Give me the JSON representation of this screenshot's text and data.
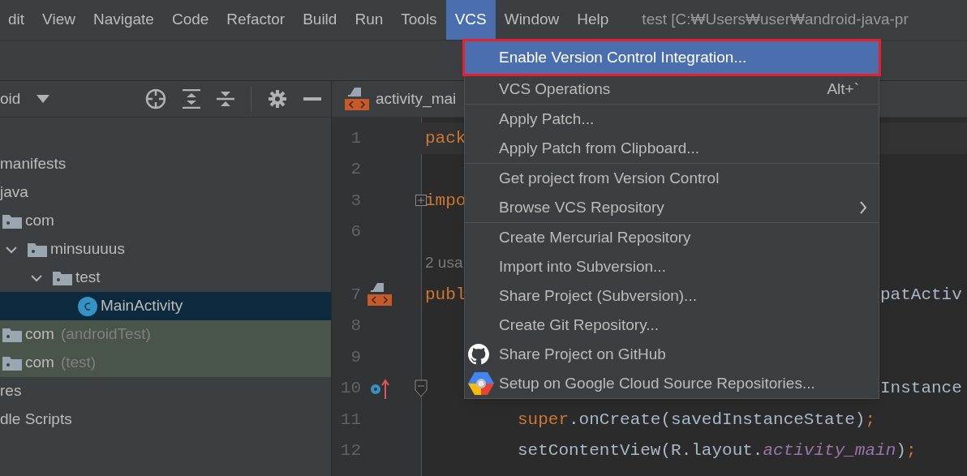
{
  "menu_bar": [
    {
      "label": "dit",
      "selected": false
    },
    {
      "label": "View",
      "selected": false
    },
    {
      "label": "Navigate",
      "selected": false
    },
    {
      "label": "Code",
      "selected": false
    },
    {
      "label": "Refactor",
      "selected": false
    },
    {
      "label": "Build",
      "selected": false
    },
    {
      "label": "Run",
      "selected": false
    },
    {
      "label": "Tools",
      "selected": false
    },
    {
      "label": "VCS",
      "selected": true
    },
    {
      "label": "Window",
      "selected": false
    },
    {
      "label": "Help",
      "selected": false
    }
  ],
  "window": {
    "title": "test [C:₩Users₩user₩android-java-pr"
  },
  "project_panel": {
    "view": "oid",
    "tree": [
      {
        "label": "manifests",
        "selected": false
      },
      {
        "label": "java",
        "selected": false,
        "children": [
          {
            "label": "com",
            "kind": "folder",
            "selected": false,
            "children": [
              {
                "label": "minsuuuus",
                "kind": "folder",
                "selected": false,
                "expanded": true,
                "children": [
                  {
                    "label": "test",
                    "kind": "folder",
                    "selected": false,
                    "expanded": true,
                    "children": [
                      {
                        "label": "MainActivity",
                        "kind": "class",
                        "selected": true
                      }
                    ]
                  }
                ]
              }
            ]
          },
          {
            "label": "com",
            "suffix": "(androidTest)",
            "kind": "test-folder",
            "selected": false
          },
          {
            "label": "com",
            "suffix": "(test)",
            "kind": "test-folder",
            "selected": false
          }
        ]
      },
      {
        "label": "res",
        "selected": false
      },
      {
        "label": "dle Scripts",
        "selected": false
      }
    ]
  },
  "editor": {
    "tab": "activity_mai",
    "lines": [
      {
        "number": "1",
        "current": true,
        "tokens": [
          {
            "text": "pack",
            "kind": "keyword"
          }
        ]
      },
      {
        "number": "2"
      },
      {
        "number": "3",
        "kind": "import",
        "tokens": [
          {
            "text": "impo",
            "kind": "keyword"
          }
        ]
      },
      {
        "number": "6"
      },
      {
        "kind": "hint",
        "tokens": [
          {
            "text": "2 usa",
            "kind": "hint"
          }
        ]
      },
      {
        "number": "7",
        "kind": "class",
        "tokens": [
          {
            "text": "publ",
            "kind": "keyword"
          }
        ],
        "right": "patActiv"
      },
      {
        "number": "8"
      },
      {
        "number": "9"
      },
      {
        "number": "10",
        "kind": "method",
        "right": "Instance"
      },
      {
        "number": "11",
        "indent": true,
        "tokens": [
          {
            "text": "super",
            "kind": "keyword"
          },
          {
            "text": ".onCreate(savedInstanceState)",
            "kind": "plain"
          },
          {
            "text": ";",
            "kind": "keyword"
          }
        ]
      },
      {
        "number": "12",
        "indent": true,
        "tokens": [
          {
            "text": "setContentView(R.layout.",
            "kind": "plain"
          },
          {
            "text": "activity_main",
            "kind": "field"
          },
          {
            "text": ")",
            "kind": "plain"
          },
          {
            "text": ";",
            "kind": "keyword"
          }
        ]
      }
    ]
  },
  "vcs_menu": [
    [
      {
        "label": "Enable Version Control Integration...",
        "selected": true,
        "outlined": true
      }
    ],
    [
      {
        "label": "VCS Operations",
        "shortcut": "Alt+`",
        "selected": false
      }
    ],
    [
      {
        "label": "Apply Patch...",
        "selected": false
      },
      {
        "label": "Apply Patch from Clipboard...",
        "selected": false
      }
    ],
    [
      {
        "label": "Get project from Version Control",
        "selected": false
      },
      {
        "label": "Browse VCS Repository",
        "submenu": true,
        "selected": false
      }
    ],
    [
      {
        "label": "Create Mercurial Repository",
        "selected": false
      },
      {
        "label": "Import into Subversion...",
        "selected": false
      },
      {
        "label": "Share Project (Subversion)...",
        "selected": false
      },
      {
        "label": "Create Git Repository...",
        "selected": false
      },
      {
        "label": "Share Project on GitHub",
        "kind": "github",
        "selected": false
      },
      {
        "label": "Setup on Google Cloud Source Repositories...",
        "kind": "cloud",
        "selected": false
      }
    ]
  ]
}
